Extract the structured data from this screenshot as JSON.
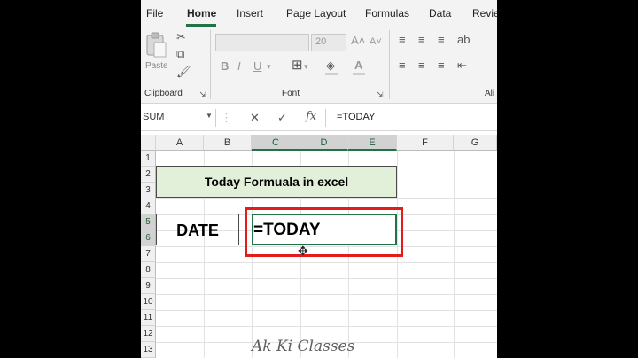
{
  "tabs": [
    "File",
    "Home",
    "Insert",
    "Page Layout",
    "Formulas",
    "Data",
    "Revie"
  ],
  "active_tab": "Home",
  "ribbon": {
    "clipboard_label": "Clipboard",
    "paste_label": "Paste",
    "font_group_label": "Font",
    "font_size": "20",
    "alignment_label": "Ali"
  },
  "formula_bar": {
    "name_box": "SUM",
    "formula": "=TODAY"
  },
  "columns": [
    "A",
    "B",
    "C",
    "D",
    "E",
    "F",
    "G"
  ],
  "rows": [
    "1",
    "2",
    "3",
    "4",
    "5",
    "6",
    "7",
    "8",
    "9",
    "10",
    "11",
    "12",
    "13"
  ],
  "cells": {
    "title": "Today Formuala in excel",
    "date_label": "DATE",
    "active_input": "=TODAY"
  },
  "watermark": "Ak Ki Classes",
  "colors": {
    "accent": "#217346",
    "title_fill": "#e2f0d9",
    "highlight": "#e31b1b"
  }
}
